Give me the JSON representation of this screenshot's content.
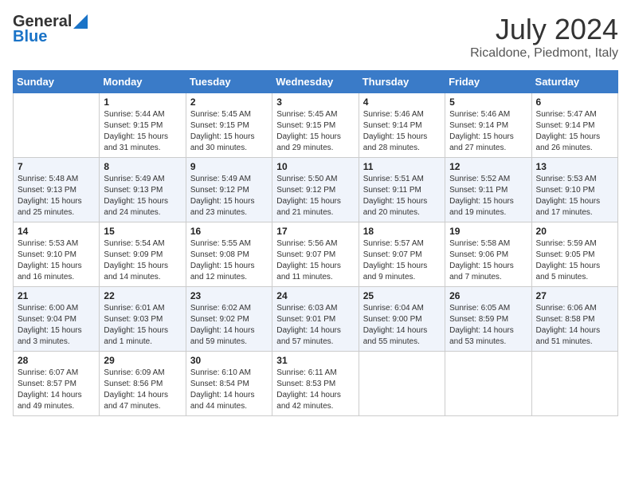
{
  "header": {
    "logo_line1": "General",
    "logo_line2": "Blue",
    "month_year": "July 2024",
    "location": "Ricaldone, Piedmont, Italy"
  },
  "days_of_week": [
    "Sunday",
    "Monday",
    "Tuesday",
    "Wednesday",
    "Thursday",
    "Friday",
    "Saturday"
  ],
  "weeks": [
    [
      {
        "day": "",
        "info": ""
      },
      {
        "day": "1",
        "info": "Sunrise: 5:44 AM\nSunset: 9:15 PM\nDaylight: 15 hours\nand 31 minutes."
      },
      {
        "day": "2",
        "info": "Sunrise: 5:45 AM\nSunset: 9:15 PM\nDaylight: 15 hours\nand 30 minutes."
      },
      {
        "day": "3",
        "info": "Sunrise: 5:45 AM\nSunset: 9:15 PM\nDaylight: 15 hours\nand 29 minutes."
      },
      {
        "day": "4",
        "info": "Sunrise: 5:46 AM\nSunset: 9:14 PM\nDaylight: 15 hours\nand 28 minutes."
      },
      {
        "day": "5",
        "info": "Sunrise: 5:46 AM\nSunset: 9:14 PM\nDaylight: 15 hours\nand 27 minutes."
      },
      {
        "day": "6",
        "info": "Sunrise: 5:47 AM\nSunset: 9:14 PM\nDaylight: 15 hours\nand 26 minutes."
      }
    ],
    [
      {
        "day": "7",
        "info": "Sunrise: 5:48 AM\nSunset: 9:13 PM\nDaylight: 15 hours\nand 25 minutes."
      },
      {
        "day": "8",
        "info": "Sunrise: 5:49 AM\nSunset: 9:13 PM\nDaylight: 15 hours\nand 24 minutes."
      },
      {
        "day": "9",
        "info": "Sunrise: 5:49 AM\nSunset: 9:12 PM\nDaylight: 15 hours\nand 23 minutes."
      },
      {
        "day": "10",
        "info": "Sunrise: 5:50 AM\nSunset: 9:12 PM\nDaylight: 15 hours\nand 21 minutes."
      },
      {
        "day": "11",
        "info": "Sunrise: 5:51 AM\nSunset: 9:11 PM\nDaylight: 15 hours\nand 20 minutes."
      },
      {
        "day": "12",
        "info": "Sunrise: 5:52 AM\nSunset: 9:11 PM\nDaylight: 15 hours\nand 19 minutes."
      },
      {
        "day": "13",
        "info": "Sunrise: 5:53 AM\nSunset: 9:10 PM\nDaylight: 15 hours\nand 17 minutes."
      }
    ],
    [
      {
        "day": "14",
        "info": "Sunrise: 5:53 AM\nSunset: 9:10 PM\nDaylight: 15 hours\nand 16 minutes."
      },
      {
        "day": "15",
        "info": "Sunrise: 5:54 AM\nSunset: 9:09 PM\nDaylight: 15 hours\nand 14 minutes."
      },
      {
        "day": "16",
        "info": "Sunrise: 5:55 AM\nSunset: 9:08 PM\nDaylight: 15 hours\nand 12 minutes."
      },
      {
        "day": "17",
        "info": "Sunrise: 5:56 AM\nSunset: 9:07 PM\nDaylight: 15 hours\nand 11 minutes."
      },
      {
        "day": "18",
        "info": "Sunrise: 5:57 AM\nSunset: 9:07 PM\nDaylight: 15 hours\nand 9 minutes."
      },
      {
        "day": "19",
        "info": "Sunrise: 5:58 AM\nSunset: 9:06 PM\nDaylight: 15 hours\nand 7 minutes."
      },
      {
        "day": "20",
        "info": "Sunrise: 5:59 AM\nSunset: 9:05 PM\nDaylight: 15 hours\nand 5 minutes."
      }
    ],
    [
      {
        "day": "21",
        "info": "Sunrise: 6:00 AM\nSunset: 9:04 PM\nDaylight: 15 hours\nand 3 minutes."
      },
      {
        "day": "22",
        "info": "Sunrise: 6:01 AM\nSunset: 9:03 PM\nDaylight: 15 hours\nand 1 minute."
      },
      {
        "day": "23",
        "info": "Sunrise: 6:02 AM\nSunset: 9:02 PM\nDaylight: 14 hours\nand 59 minutes."
      },
      {
        "day": "24",
        "info": "Sunrise: 6:03 AM\nSunset: 9:01 PM\nDaylight: 14 hours\nand 57 minutes."
      },
      {
        "day": "25",
        "info": "Sunrise: 6:04 AM\nSunset: 9:00 PM\nDaylight: 14 hours\nand 55 minutes."
      },
      {
        "day": "26",
        "info": "Sunrise: 6:05 AM\nSunset: 8:59 PM\nDaylight: 14 hours\nand 53 minutes."
      },
      {
        "day": "27",
        "info": "Sunrise: 6:06 AM\nSunset: 8:58 PM\nDaylight: 14 hours\nand 51 minutes."
      }
    ],
    [
      {
        "day": "28",
        "info": "Sunrise: 6:07 AM\nSunset: 8:57 PM\nDaylight: 14 hours\nand 49 minutes."
      },
      {
        "day": "29",
        "info": "Sunrise: 6:09 AM\nSunset: 8:56 PM\nDaylight: 14 hours\nand 47 minutes."
      },
      {
        "day": "30",
        "info": "Sunrise: 6:10 AM\nSunset: 8:54 PM\nDaylight: 14 hours\nand 44 minutes."
      },
      {
        "day": "31",
        "info": "Sunrise: 6:11 AM\nSunset: 8:53 PM\nDaylight: 14 hours\nand 42 minutes."
      },
      {
        "day": "",
        "info": ""
      },
      {
        "day": "",
        "info": ""
      },
      {
        "day": "",
        "info": ""
      }
    ]
  ]
}
